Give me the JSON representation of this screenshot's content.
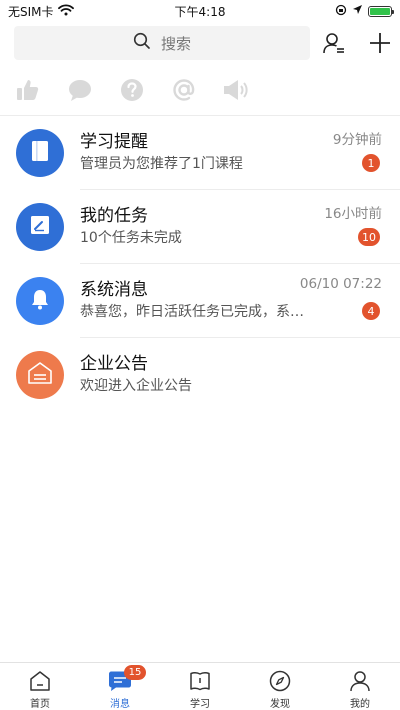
{
  "status_bar": {
    "carrier": "无SIM卡",
    "time": "下午4:18"
  },
  "header": {
    "search_placeholder": "搜索",
    "search_icon": "search-icon",
    "contacts_icon": "contacts-icon",
    "add_icon": "add-icon"
  },
  "quick_icons": [
    {
      "name": "like-icon"
    },
    {
      "name": "comment-icon"
    },
    {
      "name": "question-icon"
    },
    {
      "name": "mention-icon"
    },
    {
      "name": "announcement-icon"
    }
  ],
  "messages": [
    {
      "title": "学习提醒",
      "subtitle": "管理员为您推荐了1门课程",
      "time": "9分钟前",
      "badge": "1",
      "icon": "book-icon",
      "color": "#2f6fd6"
    },
    {
      "title": "我的任务",
      "subtitle": "10个任务未完成",
      "time": "16小时前",
      "badge": "10",
      "icon": "task-icon",
      "color": "#2f6fd6"
    },
    {
      "title": "系统消息",
      "subtitle": "恭喜您，昨日活跃任务已完成，系…",
      "time": "06/10 07:22",
      "badge": "4",
      "icon": "bell-icon",
      "color": "#3b82f0"
    },
    {
      "title": "企业公告",
      "subtitle": "欢迎进入企业公告",
      "time": "",
      "badge": "",
      "icon": "briefcase-icon",
      "color": "#ee7a4c"
    }
  ],
  "tabs": [
    {
      "label": "首页",
      "icon": "home-icon",
      "active": false,
      "badge": ""
    },
    {
      "label": "消息",
      "icon": "message-icon",
      "active": true,
      "badge": "15"
    },
    {
      "label": "学习",
      "icon": "study-icon",
      "active": false,
      "badge": ""
    },
    {
      "label": "发现",
      "icon": "compass-icon",
      "active": false,
      "badge": ""
    },
    {
      "label": "我的",
      "icon": "profile-icon",
      "active": false,
      "badge": ""
    }
  ],
  "colors": {
    "accent": "#2f6fd6",
    "badge": "#e2532d",
    "battery": "#31c24a"
  }
}
